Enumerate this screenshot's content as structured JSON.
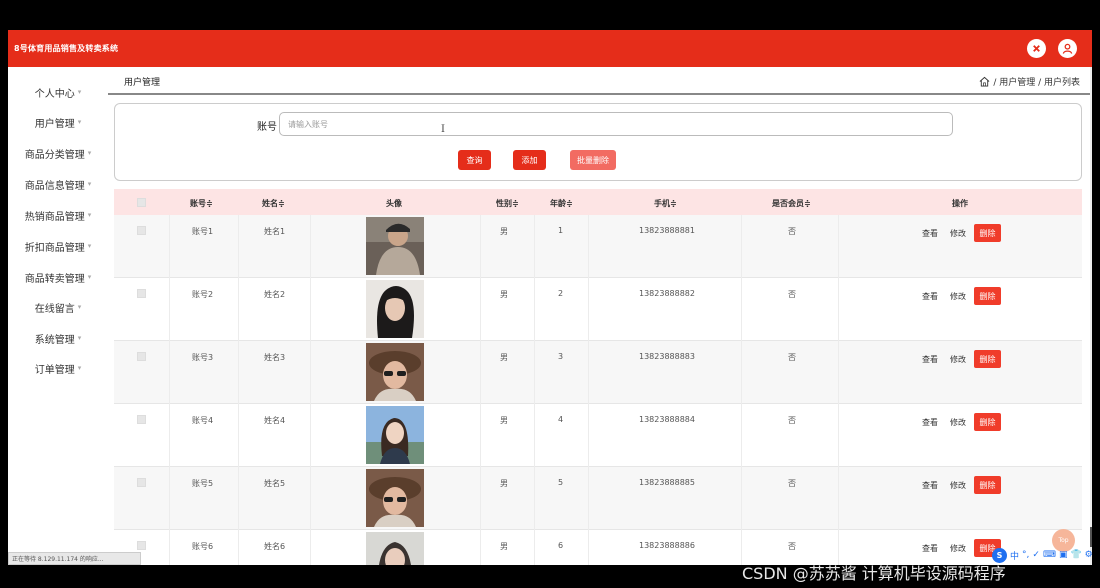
{
  "app": {
    "title": "8号体育用品销售及转卖系统"
  },
  "sidebar": {
    "items": [
      {
        "label": "个人中心"
      },
      {
        "label": "用户管理"
      },
      {
        "label": "商品分类管理"
      },
      {
        "label": "商品信息管理"
      },
      {
        "label": "热销商品管理"
      },
      {
        "label": "折扣商品管理"
      },
      {
        "label": "商品转卖管理"
      },
      {
        "label": "在线留言"
      },
      {
        "label": "系统管理"
      },
      {
        "label": "订单管理"
      }
    ],
    "caret": "▾"
  },
  "breadcrumb": {
    "page_title": "用户管理",
    "path": "/ 用户管理 / 用户列表"
  },
  "search": {
    "account_label": "账号",
    "account_placeholder": "请输入账号",
    "query_button": "查询",
    "add_button": "添加",
    "batch_delete_button": "批量删除"
  },
  "table": {
    "headers": {
      "account": "账号≑",
      "name": "姓名≑",
      "avatar": "头像",
      "gender": "性别≑",
      "age": "年龄≑",
      "phone": "手机≑",
      "member": "是否会员≑",
      "actions": "操作"
    },
    "rows": [
      {
        "account": "账号1",
        "name": "姓名1",
        "gender": "男",
        "age": "1",
        "phone": "13823888881",
        "member": "否"
      },
      {
        "account": "账号2",
        "name": "姓名2",
        "gender": "男",
        "age": "2",
        "phone": "13823888882",
        "member": "否"
      },
      {
        "account": "账号3",
        "name": "姓名3",
        "gender": "男",
        "age": "3",
        "phone": "13823888883",
        "member": "否"
      },
      {
        "account": "账号4",
        "name": "姓名4",
        "gender": "男",
        "age": "4",
        "phone": "13823888884",
        "member": "否"
      },
      {
        "account": "账号5",
        "name": "姓名5",
        "gender": "男",
        "age": "5",
        "phone": "13823888885",
        "member": "否"
      },
      {
        "account": "账号6",
        "name": "姓名6",
        "gender": "男",
        "age": "6",
        "phone": "13823888886",
        "member": "否"
      }
    ],
    "view_label": "查看",
    "edit_label": "修改",
    "delete_label": "删除"
  },
  "status_bar": {
    "text": "正在等待 8.129.11.174 的响应..."
  },
  "back_to_top": "Top",
  "watermark": "CSDN @苏苏酱    计算机毕设源码程序",
  "toolbar": {
    "main": "S",
    "items": [
      "中",
      "°,",
      "✓",
      "⌨",
      "▣",
      "👕",
      "⚙"
    ]
  },
  "colors": {
    "header": "#e52d1a",
    "primary_button": "#e52d1a",
    "batch_delete_button": "#f26b62",
    "table_header": "#fde4e4"
  }
}
